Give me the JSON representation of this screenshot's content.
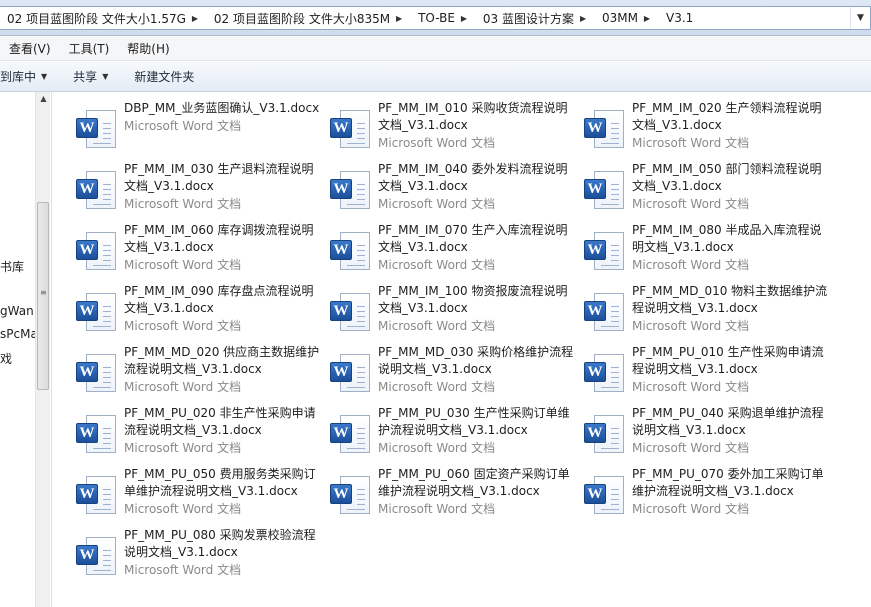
{
  "breadcrumb": {
    "items": [
      "02 项目蓝图阶段 文件大小1.57G",
      "02 项目蓝图阶段 文件大小835M",
      "TO-BE",
      "03 蓝图设计方案",
      "03MM",
      "V3.1"
    ],
    "arrow": "▶",
    "dropdown": "▼"
  },
  "menu": [
    "查看(V)",
    "工具(T)",
    "帮助(H)"
  ],
  "commands": [
    {
      "label": "到库中",
      "caret": "▼"
    },
    {
      "label": "共享",
      "caret": "▼"
    },
    {
      "label": "新建文件夹",
      "caret": ""
    }
  ],
  "nav": {
    "items": [
      "",
      "书库",
      "gWan",
      "sPcMa",
      "戏"
    ],
    "scroll_up": "▲",
    "grip": "≡"
  },
  "file_type_label": "Microsoft Word 文档",
  "icon_badge": "W",
  "files": [
    "DBP_MM_业务蓝图确认_V3.1.docx",
    "PF_MM_IM_010 采购收货流程说明文档_V3.1.docx",
    "PF_MM_IM_020 生产领料流程说明文档_V3.1.docx",
    "PF_MM_IM_030 生产退料流程说明文档_V3.1.docx",
    "PF_MM_IM_040 委外发料流程说明文档_V3.1.docx",
    "PF_MM_IM_050 部门领料流程说明文档_V3.1.docx",
    "PF_MM_IM_060 库存调拨流程说明文档_V3.1.docx",
    "PF_MM_IM_070 生产入库流程说明文档_V3.1.docx",
    "PF_MM_IM_080 半成品入库流程说明文档_V3.1.docx",
    "PF_MM_IM_090 库存盘点流程说明文档_V3.1.docx",
    "PF_MM_IM_100 物资报废流程说明文档_V3.1.docx",
    "PF_MM_MD_010 物料主数据维护流程说明文档_V3.1.docx",
    "PF_MM_MD_020 供应商主数据维护流程说明文档_V3.1.docx",
    "PF_MM_MD_030 采购价格维护流程说明文档_V3.1.docx",
    "PF_MM_PU_010 生产性采购申请流程说明文档_V3.1.docx",
    "PF_MM_PU_020 非生产性采购申请流程说明文档_V3.1.docx",
    "PF_MM_PU_030 生产性采购订单维护流程说明文档_V3.1.docx",
    "PF_MM_PU_040 采购退单维护流程说明文档_V3.1.docx",
    "PF_MM_PU_050 费用服务类采购订单维护流程说明文档_V3.1.docx",
    "PF_MM_PU_060 固定资产采购订单维护流程说明文档_V3.1.docx",
    "PF_MM_PU_070 委外加工采购订单维护流程说明文档_V3.1.docx",
    "PF_MM_PU_080 采购发票校验流程说明文档_V3.1.docx"
  ]
}
